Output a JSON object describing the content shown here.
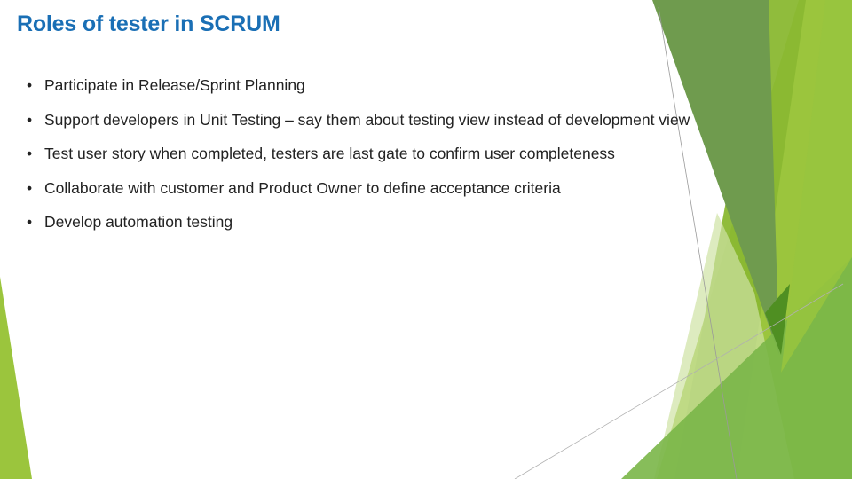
{
  "slide": {
    "title": "Roles of tester in SCRUM",
    "bullet_glyph": "•",
    "bullets": [
      "Participate in Release/Sprint Planning",
      "Support developers in Unit Testing – say them about testing view instead of development view",
      "Test user story when completed, testers are last gate to confirm user completeness",
      "Collaborate with customer and Product Owner to define acceptance criteria",
      "Develop automation testing"
    ]
  },
  "theme": {
    "title_color": "#1a6fb5",
    "text_color": "#222222",
    "greens": [
      "#6f9b4e",
      "#8ab832",
      "#9bc53d",
      "#7ab648",
      "#d9e9b8",
      "#5a9a2a"
    ]
  }
}
